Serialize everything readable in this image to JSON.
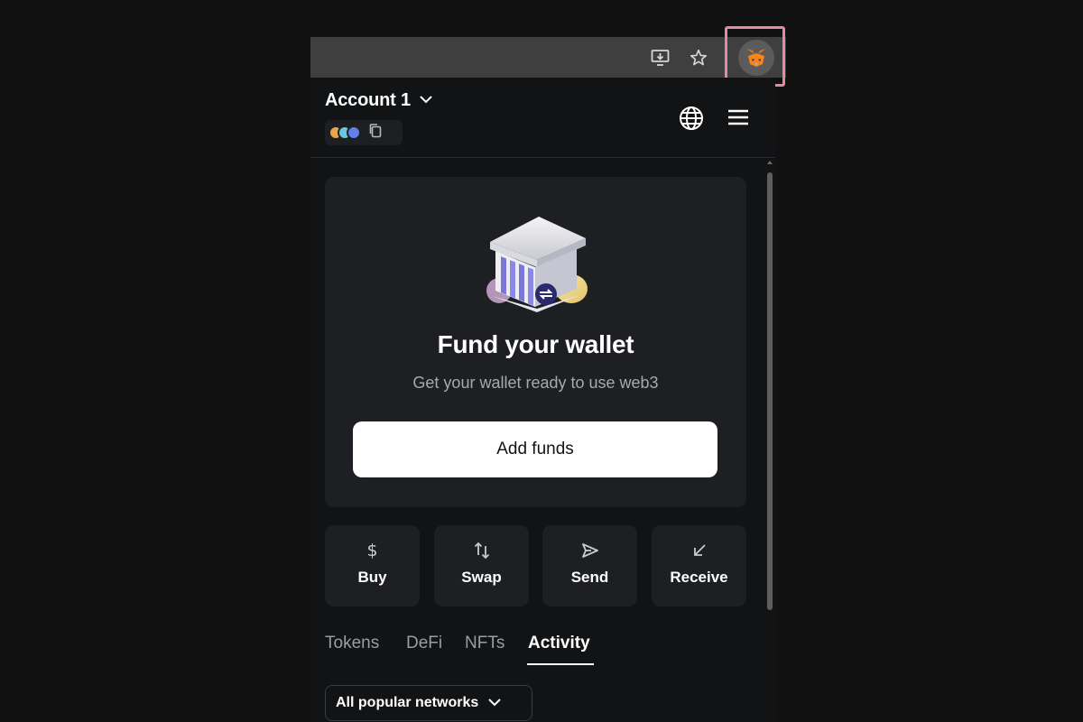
{
  "browser": {
    "install_icon": "install-app-icon",
    "star_icon": "bookmark-star-icon",
    "extension_icon": "metamask-fox-icon"
  },
  "header": {
    "account_name": "Account 1",
    "account_chevron": "chevron-down-icon",
    "globe_icon": "globe-icon",
    "menu_icon": "hamburger-menu-icon",
    "network_dots": [
      "#e8a54b",
      "#6cc6e0",
      "#627eea"
    ]
  },
  "fund_card": {
    "title": "Fund your wallet",
    "subtitle": "Get your wallet ready to use web3",
    "button_label": "Add funds"
  },
  "actions": [
    {
      "label": "Buy",
      "icon": "dollar-icon"
    },
    {
      "label": "Swap",
      "icon": "swap-arrows-icon"
    },
    {
      "label": "Send",
      "icon": "send-arrow-icon"
    },
    {
      "label": "Receive",
      "icon": "receive-arrow-icon"
    }
  ],
  "tabs": {
    "items": [
      "Tokens",
      "DeFi",
      "NFTs",
      "Activity"
    ],
    "active": "Activity"
  },
  "network_filter": {
    "label": "All popular networks"
  },
  "colors": {
    "background": "#111111",
    "popup_bg": "#121314",
    "card_bg": "#1e1f22",
    "highlight_border": "#e38b9c",
    "primary_button_bg": "#ffffff"
  }
}
